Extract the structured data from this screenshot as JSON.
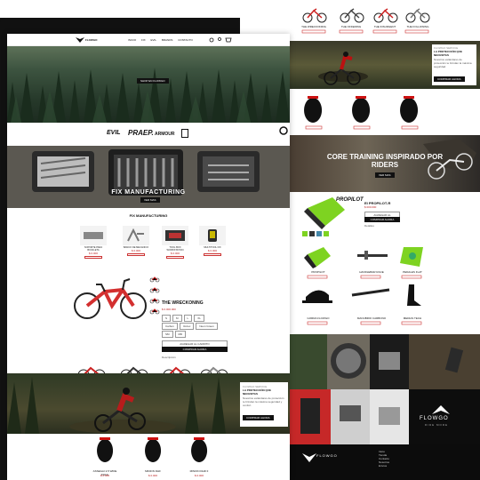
{
  "brand": {
    "name": "FLOWGO"
  },
  "nav": {
    "links": [
      "INICIO",
      "FIX",
      "EVIL",
      "BRANDS",
      "CONTACTO"
    ]
  },
  "hero": {
    "button": "SHOP EN FLOWGO"
  },
  "brands": {
    "items": [
      "EVIL",
      "PRAEP.",
      "ARMOUR"
    ]
  },
  "fix_banner": {
    "title": "FIX MANUFACTURING",
    "button": "VER MAS"
  },
  "fix_section": {
    "title": "FIX MANUFACTURING",
    "products": [
      {
        "name": "SOPORTE PARA BICICLETA",
        "price": "$ 0.000"
      },
      {
        "name": "BANCO DE MECANICO",
        "price": "$ 0.000"
      },
      {
        "name": "TOOL BOX WORKSTATION",
        "price": "$ 0.000"
      },
      {
        "name": "MULTITOOL FIX",
        "price": "$ 0.000"
      }
    ]
  },
  "featured": {
    "title": "THE WRECKONING",
    "price": "$ 0.000.000",
    "sizes": [
      "S",
      "M",
      "L",
      "XL"
    ],
    "colors": [
      "Carbon",
      "Vortex",
      "Neon Green"
    ],
    "options": [
      "SM",
      "MD"
    ],
    "add_to_cart": "AGREGAR AL CARRITO",
    "buy_now": "COMPRAR AHORA",
    "description_label": "Descripción"
  },
  "bikes_row": [
    {
      "name": "THE WRECKONING",
      "price": "$ 0.000.000"
    },
    {
      "name": "THE OFFERING",
      "price": "$ 0.000.000"
    },
    {
      "name": "THE INSURGENT",
      "price": "$ 0.000.000"
    },
    {
      "name": "THE FOLLOWING",
      "price": "$ 0.000.000"
    }
  ],
  "ride_banner": {
    "label": "FLOWGO SERVICE",
    "title": "LA PROTECCIÓN QUE NECESITAS",
    "text": "Nuestros estándares de protección te brindan la máxima seguridad y confort.",
    "button": "COMPRAR AHORA"
  },
  "tires": [
    {
      "name": "ASSEGAI 2.5 WIDE TRAIL",
      "price": "$ 0.000"
    },
    {
      "name": "MINION DHF",
      "price": "$ 0.000"
    },
    {
      "name": "MINION DHR II",
      "price": "$ 0.000"
    }
  ],
  "back_page": {
    "bikes": [
      {
        "name": "THE WRECKONING",
        "price": "$ 0.000.000"
      },
      {
        "name": "THE OFFERING",
        "price": "$ 0.000.000"
      },
      {
        "name": "THE INSURGENT",
        "price": "$ 0.000.000"
      },
      {
        "name": "THE FOLLOWING",
        "price": "$ 0.000.000"
      }
    ],
    "promo": {
      "label": "FLOWGO SERVICE",
      "title": "LA PROTECCIÓN QUE NECESITAS",
      "text": "Nuestros estándares de protección te brindan la máxima seguridad.",
      "button": "COMPRAR AHORA"
    },
    "core": {
      "title": "CORE TRAINING INSPIRADO POR RIDERS",
      "button": "VER MAS"
    },
    "product": {
      "brand": "PROPILOT",
      "title": "EI PROPILOT-R",
      "price": "$ 000.000",
      "add": "AGREGAR AL CARRITO",
      "buy": "COMPRAR AHORA",
      "detail": "Detalles"
    },
    "grid": [
      {
        "name": "PROPILOT",
        "price": "$ 0.000"
      },
      {
        "name": "HANDLEBAR RACE",
        "price": "$ 0.000"
      },
      {
        "name": "PEDALES FLAT",
        "price": "$ 0.000"
      },
      {
        "name": "GORRA FLOWGO",
        "price": "$ 0.000"
      },
      {
        "name": "MANUBRIO CARBONO",
        "price": "$ 0.000"
      },
      {
        "name": "MEDIAS TECH",
        "price": "$ 0.000"
      }
    ],
    "footer": {
      "logo": "FLOWGO",
      "tagline": "RIDE MORE",
      "links": [
        "Inicio",
        "Tienda",
        "Contacto",
        "Nosotros",
        "Envíos"
      ]
    }
  }
}
